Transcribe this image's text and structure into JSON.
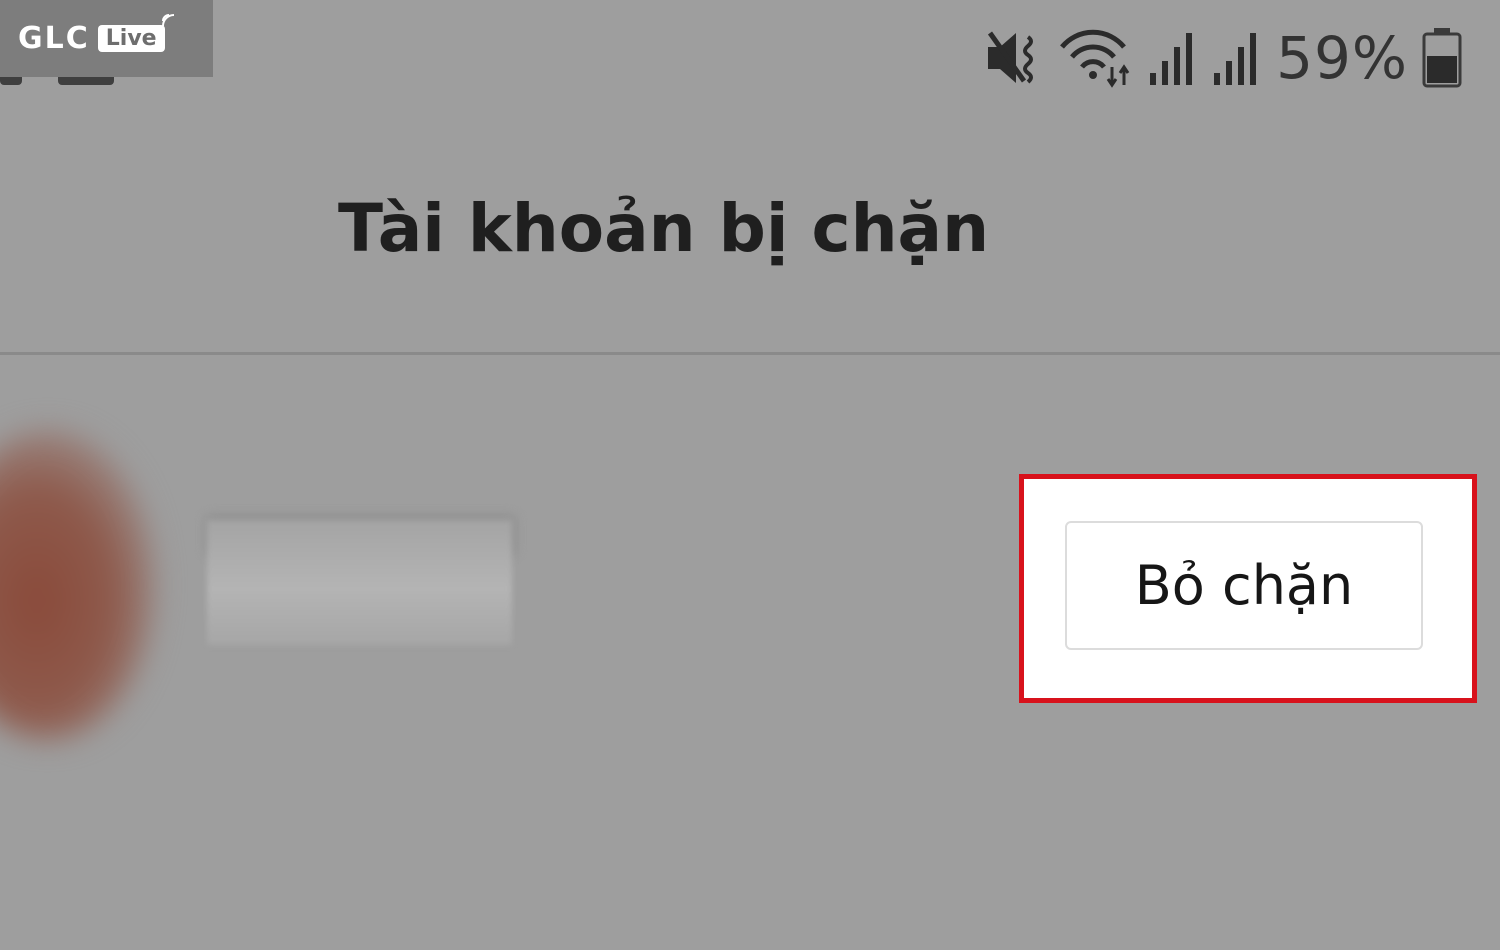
{
  "watermark": {
    "brand": "GLC",
    "badge": "Live"
  },
  "status_bar": {
    "icons": [
      "mute-vibrate-icon",
      "wifi-icon",
      "signal-sim1-icon",
      "signal-sim2-icon",
      "battery-icon"
    ],
    "battery_percent": "59%"
  },
  "header": {
    "title": "Tài khoản bị chặn"
  },
  "blocked_account": {
    "avatar": "blurred-avatar",
    "unblock_label": "Bỏ chặn"
  },
  "colors": {
    "background": "#9e9e9e",
    "highlight": "#d8121c",
    "button_bg": "#ffffff"
  }
}
